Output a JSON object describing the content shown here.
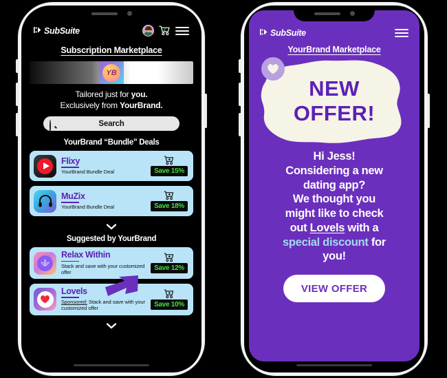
{
  "left_phone": {
    "header": {
      "brand": "SubSuite",
      "avatar_icon": "user-avatar",
      "cart_icon": "shopping-cart-icon",
      "menu_icon": "hamburger-menu-icon"
    },
    "page_title": "Subscription Marketplace",
    "banner": {
      "logo_text": "YB"
    },
    "tagline_line1_a": "Tailored just for ",
    "tagline_line1_b": "you.",
    "tagline_line2_a": "Exclusively from ",
    "tagline_line2_b": "YourBrand.",
    "search": {
      "label": "Search",
      "icon": "search-icon"
    },
    "bundle_section": {
      "title": "YourBrand “Bundle” Deals",
      "items": [
        {
          "name": "Flixy",
          "subtitle": "YourBrand Bundle Deal",
          "badge": "Save 15%",
          "icon": "flixy-app-icon"
        },
        {
          "name": "MuZix",
          "subtitle": "YourBrand Bundle Deal",
          "badge": "Save 18%",
          "icon": "muzix-app-icon"
        }
      ]
    },
    "suggested_section": {
      "title": "Suggested by YourBrand",
      "items": [
        {
          "name": "Relax Within",
          "subtitle": "Stack and save with your customized offer",
          "sponsored": "",
          "badge": "Save 12%",
          "icon": "relax-within-app-icon"
        },
        {
          "name": "Lovels",
          "subtitle": "Stack and save with your customized offer",
          "sponsored": "Sponsored:",
          "badge": "Save 10%",
          "icon": "lovels-app-icon"
        }
      ]
    },
    "expand_icon": "chevron-down-icon"
  },
  "right_phone": {
    "header": {
      "brand": "SubSuite",
      "menu_icon": "hamburger-menu-icon"
    },
    "page_title": "YourBrand Marketplace",
    "heart_icon": "heart-icon",
    "headline_line1": "NEW",
    "headline_line2": "OFFER!",
    "message": {
      "l1": "Hi Jess!",
      "l2": "Considering a new",
      "l3": "dating app?",
      "l4": "We thought you",
      "l5": "might like to check",
      "l6_a": "out ",
      "l6_link": "Lovels",
      "l6_b": " with a",
      "l7_hl": "special discount",
      "l7_b": " for",
      "l8": "you!"
    },
    "cta_label": "VIEW OFFER"
  },
  "colors": {
    "purple": "#6b2fbd",
    "deep_purple": "#5b21b6",
    "card_blue": "#b9e4f7",
    "badge_green": "#3fe23f",
    "cream": "#f6f3e7",
    "highlight_blue": "#a5d8f3"
  }
}
